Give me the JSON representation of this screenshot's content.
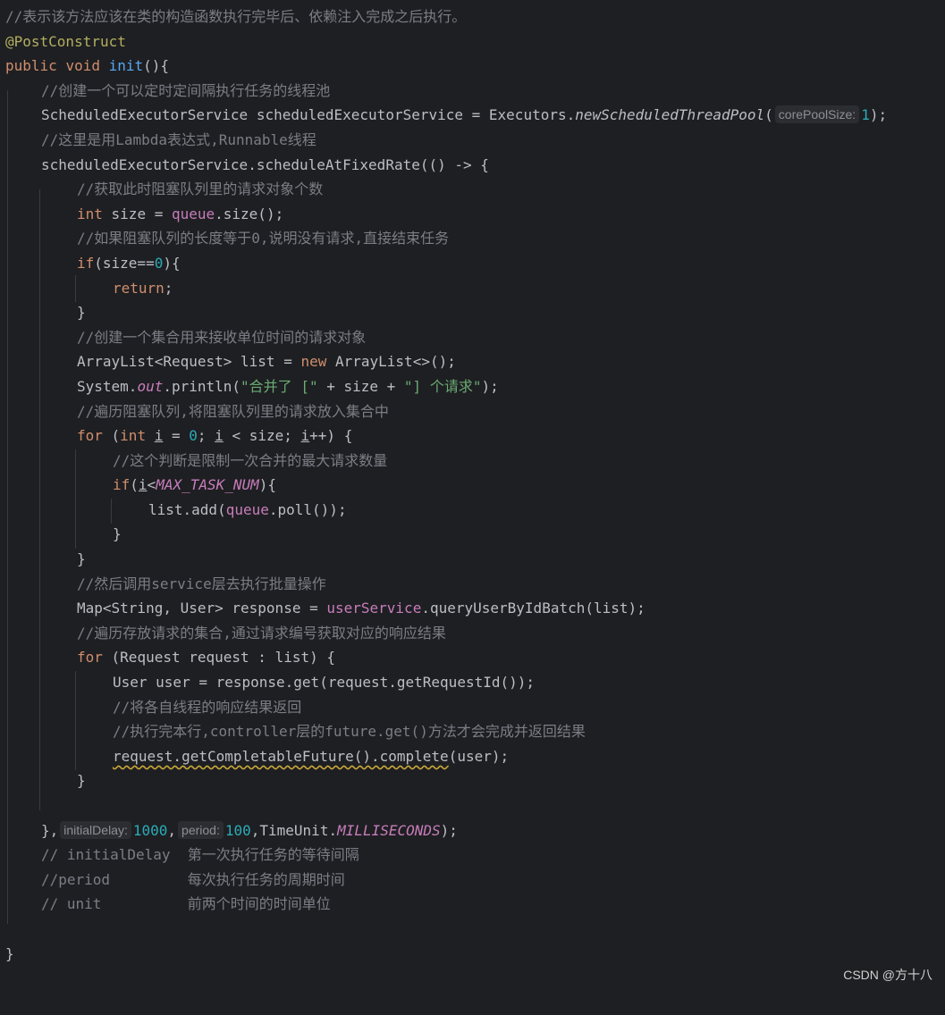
{
  "watermark": "CSDN @方十八",
  "lines": {
    "l1": "//表示该方法应该在类的构造函数执行完毕后、依赖注入完成之后执行。",
    "l2": "@PostConstruct",
    "l3_kw1": "public",
    "l3_kw2": "void",
    "l3_fn": "init",
    "l3_rest": "(){",
    "l4": "//创建一个可以定时定间隔执行任务的线程池",
    "l5_a": "ScheduledExecutorService scheduledExecutorService = Executors.",
    "l5_method": "newScheduledThreadPool",
    "l5_paren": "(",
    "l5_hint": "corePoolSize:",
    "l5_num": "1",
    "l5_end": ");",
    "l6": "//这里是用Lambda表达式,Runnable线程",
    "l7": "scheduledExecutorService.scheduleAtFixedRate(() -> {",
    "l8": "//获取此时阻塞队列里的请求对象个数",
    "l9_kw": "int",
    "l9_a": " size = ",
    "l9_field": "queue",
    "l9_b": ".size();",
    "l10": "//如果阻塞队列的长度等于0,说明没有请求,直接结束任务",
    "l11_kw": "if",
    "l11_a": "(size==",
    "l11_num": "0",
    "l11_b": "){",
    "l12_kw": "return",
    "l12_b": ";",
    "l13": "}",
    "l14": "//创建一个集合用来接收单位时间的请求对象",
    "l15_a": "ArrayList<Request> list = ",
    "l15_kw": "new",
    "l15_b": " ArrayList<>();",
    "l16_a": "System.",
    "l16_field": "out",
    "l16_b": ".println(",
    "l16_str1": "\"合并了 [\"",
    "l16_c": " + size + ",
    "l16_str2": "\"] 个请求\"",
    "l16_d": ");",
    "l17": "//遍历阻塞队列,将阻塞队列里的请求放入集合中",
    "l18_kw1": "for",
    "l18_a": " (",
    "l18_kw2": "int",
    "l18_sp": " ",
    "l18_i1": "i",
    "l18_b": " = ",
    "l18_num": "0",
    "l18_c": "; ",
    "l18_i2": "i",
    "l18_d": " < size; ",
    "l18_i3": "i",
    "l18_e": "++) {",
    "l19": "//这个判断是限制一次合并的最大请求数量",
    "l20_kw": "if",
    "l20_a": "(",
    "l20_i": "i",
    "l20_b": "<",
    "l20_const": "MAX_TASK_NUM",
    "l20_c": "){",
    "l21_a": "list.add(",
    "l21_field": "queue",
    "l21_b": ".poll());",
    "l22": "}",
    "l23": "}",
    "l24": "//然后调用service层去执行批量操作",
    "l25_a": "Map<String, User> response = ",
    "l25_field": "userService",
    "l25_b": ".queryUserByIdBatch(list);",
    "l26": "//遍历存放请求的集合,通过请求编号获取对应的响应结果",
    "l27_kw": "for",
    "l27_a": " (Request request : list) {",
    "l28": "User user = response.get(request.getRequestId());",
    "l29": "//将各自线程的响应结果返回",
    "l30": "//执行完本行,controller层的future.get()方法才会完成并返回结果",
    "l31_a": "request.getCompletableFuture().complete",
    "l31_b": "(user);",
    "l32": "}",
    "l34_a": "},",
    "l34_hint1": "initialDelay:",
    "l34_num1": "1000",
    "l34_b": ",",
    "l34_hint2": "period:",
    "l34_num2": "100",
    "l34_c": ",TimeUnit.",
    "l34_const": "MILLISECONDS",
    "l34_d": ");",
    "l35": "// initialDelay  第一次执行任务的等待间隔",
    "l36": "//period         每次执行任务的周期时间",
    "l37": "// unit          前两个时间的时间单位",
    "l39": "}"
  }
}
